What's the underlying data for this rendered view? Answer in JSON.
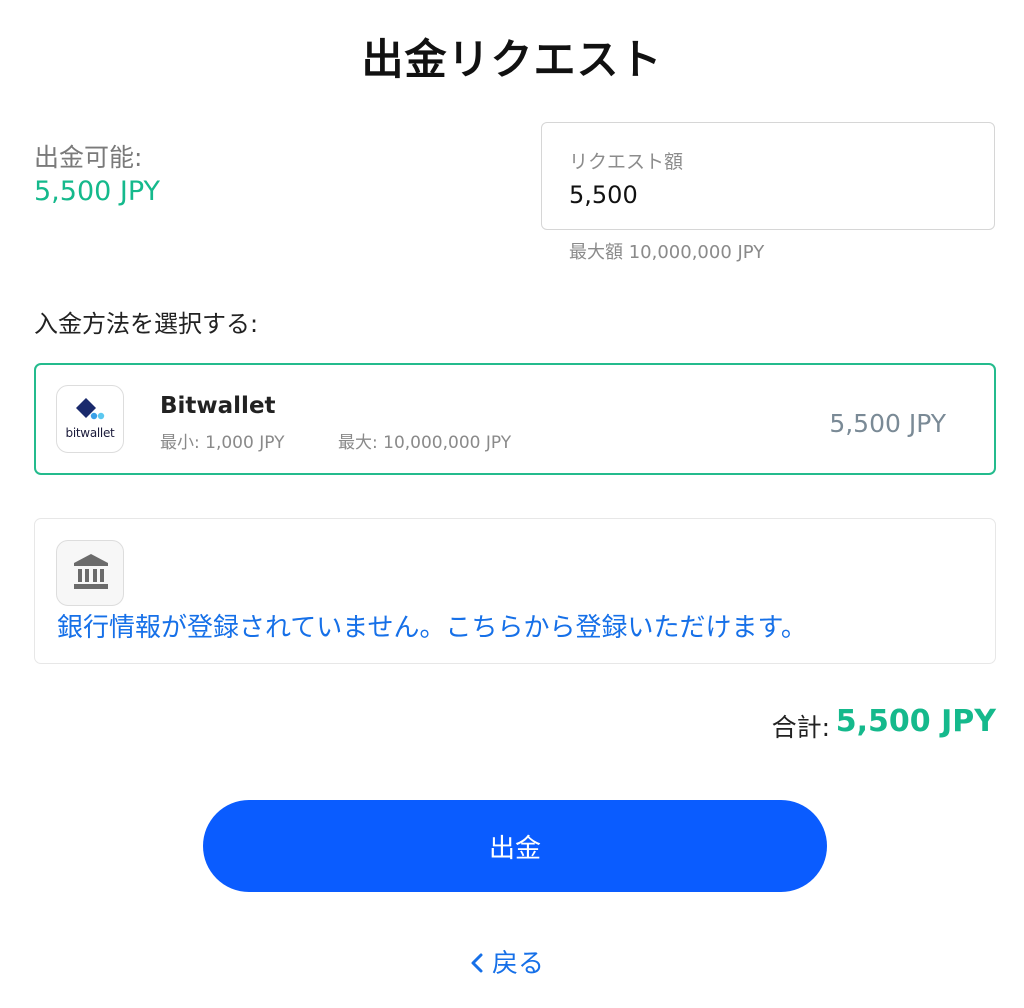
{
  "header": {
    "title": "出金リクエスト"
  },
  "balance": {
    "label": "出金可能:",
    "value": "5,500 JPY"
  },
  "request": {
    "label": "リクエスト額",
    "value": "5,500",
    "max_note": "最大額 10,000,000 JPY"
  },
  "methods": {
    "heading": "入金方法を選択する:",
    "bitwallet": {
      "logo_text": "bitwallet",
      "name": "Bitwallet",
      "min": "最小: 1,000 JPY",
      "max": "最大: 10,000,000 JPY",
      "amount": "5,500 JPY",
      "selected": true,
      "icon": "bitwallet-logo"
    },
    "bank": {
      "icon": "bank-icon",
      "message": "銀行情報が登録されていません。こちらから登録いただけます。"
    }
  },
  "summary": {
    "total_label": "合計:",
    "total_value": "5,500 JPY"
  },
  "actions": {
    "submit_label": "出金",
    "back_label": "戻る",
    "back_icon": "chevron-left-icon"
  },
  "colors": {
    "accent_green": "#15b98c",
    "primary_blue": "#0a5cff",
    "link_blue": "#1670e8",
    "selected_border": "#24bb8d"
  }
}
